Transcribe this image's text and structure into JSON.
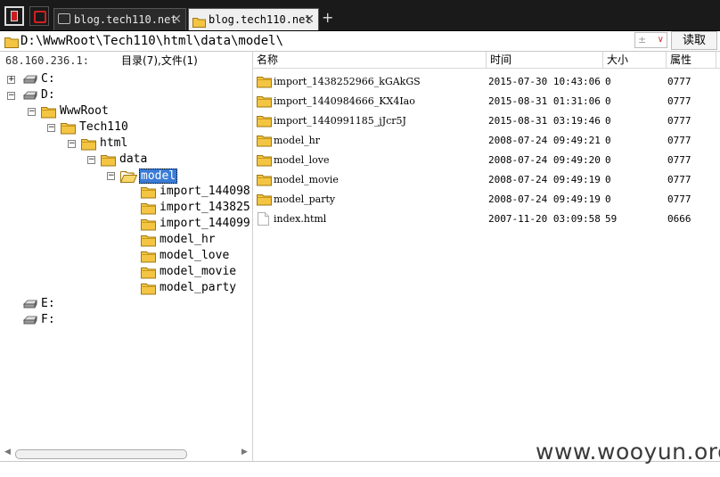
{
  "tabs": [
    {
      "label": "blog.tech110.net",
      "active": false
    },
    {
      "label": "blog.tech110.net",
      "active": true
    }
  ],
  "address": {
    "path": "D:\\WwwRoot\\Tech110\\html\\data\\model\\",
    "dropdown_symbol": "±",
    "read_button": "读取"
  },
  "left_panel": {
    "ip": "68.160.236.1:",
    "counts": "目录(7),文件(1)"
  },
  "tree": [
    {
      "label": "C:",
      "type": "drive",
      "depth": 0,
      "expander": "+"
    },
    {
      "label": "D:",
      "type": "drive",
      "depth": 0,
      "expander": "-"
    },
    {
      "label": "WwwRoot",
      "type": "folder",
      "depth": 1,
      "expander": "-"
    },
    {
      "label": "Tech110",
      "type": "folder",
      "depth": 2,
      "expander": "-"
    },
    {
      "label": "html",
      "type": "folder",
      "depth": 3,
      "expander": "-"
    },
    {
      "label": "data",
      "type": "folder",
      "depth": 4,
      "expander": "-"
    },
    {
      "label": "model",
      "type": "folder-open",
      "depth": 5,
      "expander": "-",
      "selected": true
    },
    {
      "label": "import_144098",
      "type": "folder",
      "depth": 6
    },
    {
      "label": "import_143825",
      "type": "folder",
      "depth": 6
    },
    {
      "label": "import_144099",
      "type": "folder",
      "depth": 6
    },
    {
      "label": "model_hr",
      "type": "folder",
      "depth": 6
    },
    {
      "label": "model_love",
      "type": "folder",
      "depth": 6
    },
    {
      "label": "model_movie",
      "type": "folder",
      "depth": 6
    },
    {
      "label": "model_party",
      "type": "folder",
      "depth": 6
    },
    {
      "label": "E:",
      "type": "drive",
      "depth": 0
    },
    {
      "label": "F:",
      "type": "drive",
      "depth": 0
    }
  ],
  "columns": {
    "name": "名称",
    "time": "时间",
    "size": "大小",
    "attr": "属性"
  },
  "files": [
    {
      "type": "folder",
      "name": "import_1438252966_kGAkGS",
      "time": "2015-07-30 10:43:06",
      "size": "0",
      "attr": "0777"
    },
    {
      "type": "folder",
      "name": "import_1440984666_KX4Iao",
      "time": "2015-08-31 01:31:06",
      "size": "0",
      "attr": "0777"
    },
    {
      "type": "folder",
      "name": "import_1440991185_jJcr5J",
      "time": "2015-08-31 03:19:46",
      "size": "0",
      "attr": "0777"
    },
    {
      "type": "folder",
      "name": "model_hr",
      "time": "2008-07-24 09:49:21",
      "size": "0",
      "attr": "0777"
    },
    {
      "type": "folder",
      "name": "model_love",
      "time": "2008-07-24 09:49:20",
      "size": "0",
      "attr": "0777"
    },
    {
      "type": "folder",
      "name": "model_movie",
      "time": "2008-07-24 09:49:19",
      "size": "0",
      "attr": "0777"
    },
    {
      "type": "folder",
      "name": "model_party",
      "time": "2008-07-24 09:49:19",
      "size": "0",
      "attr": "0777"
    },
    {
      "type": "file",
      "name": "index.html",
      "time": "2007-11-20 03:09:58",
      "size": "59",
      "attr": "0666"
    }
  ],
  "watermark": "www.wooyun.org",
  "colors": {
    "folder": "#f4c542",
    "selection": "#3a7bd5",
    "tabbar": "#1a1a1a"
  },
  "icons": {
    "drive": "drive-icon",
    "folder": "folder-icon",
    "file": "file-icon"
  }
}
